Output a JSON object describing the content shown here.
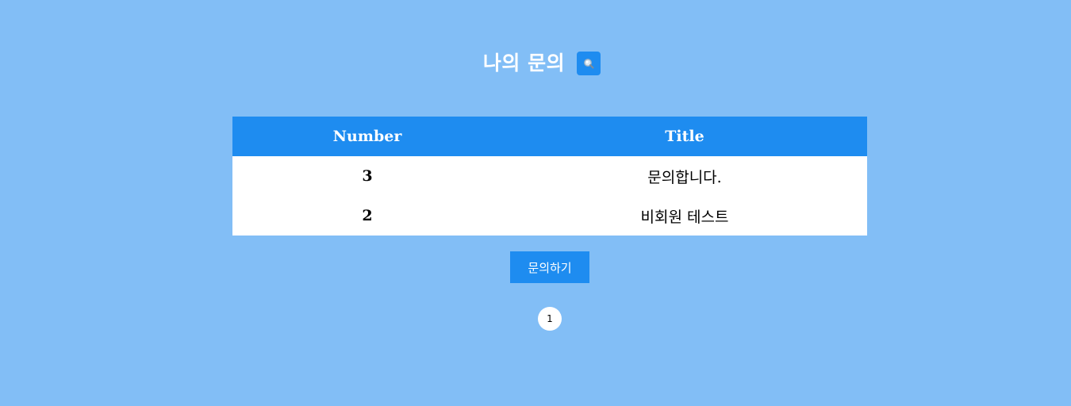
{
  "header": {
    "title": "나의 문의",
    "search_icon": "search-icon"
  },
  "table": {
    "columns": [
      "Number",
      "Title"
    ],
    "rows": [
      {
        "number": "3",
        "title": "문의합니다."
      },
      {
        "number": "2",
        "title": "비회원 테스트"
      }
    ]
  },
  "actions": {
    "ask_label": "문의하기"
  },
  "pagination": {
    "pages": [
      "1"
    ],
    "current": "1"
  },
  "colors": {
    "background": "#82bef6",
    "accent": "#1e8cf0",
    "surface": "#ffffff"
  }
}
